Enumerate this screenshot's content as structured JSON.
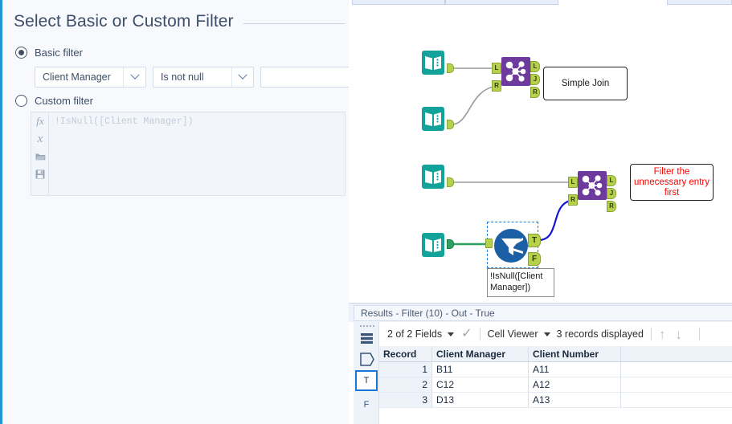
{
  "config_panel": {
    "title": "Select Basic or Custom Filter",
    "basic_filter": {
      "label": "Basic filter",
      "selected": true,
      "field": "Client Manager",
      "operator": "Is not null",
      "value": "",
      "value_placeholder": ""
    },
    "custom_filter": {
      "label": "Custom filter",
      "selected": false,
      "expression": "!IsNull([Client Manager])",
      "toolbar": {
        "function_icon": "fx",
        "variable_icon": "x",
        "open_icon": "folder-open",
        "save_icon": "floppy-save"
      }
    }
  },
  "canvas": {
    "tools": {
      "input_1_name": "input-data-tool",
      "input_2_name": "input-data-tool",
      "input_3_name": "input-data-tool",
      "input_4_name": "input-data-tool",
      "join_1_name": "join-tool",
      "join_2_name": "join-tool",
      "filter_name": "filter-tool"
    },
    "ports": {
      "left": "L",
      "right": "R",
      "join": "J",
      "true": "T",
      "false": "F"
    },
    "annotations": [
      {
        "text": "Simple Join",
        "color": "#1a1a1a"
      },
      {
        "text": "Filter the unnecessary entry first",
        "color": "#ff0000"
      }
    ],
    "filter_caption": "!IsNull([Client Manager])",
    "colors": {
      "input_tool": "#13a39a",
      "join_tool": "#6e3a9e",
      "filter_tool": "#1d5fa4",
      "port": "#b7d24a",
      "selected_wire": "#1414d8",
      "green_wire": "#2fa05f",
      "grey_wire": "#9a9a9a"
    }
  },
  "results": {
    "header": "Results - Filter (10) - Out - True",
    "toolbar": {
      "fields": "2 of 2 Fields",
      "check_icon": "check-icon",
      "view_mode": "Cell Viewer",
      "records_displayed": "3 records displayed",
      "up_arrow": "↑",
      "down_arrow": "↓"
    },
    "sidebar": {
      "drag_handle": "drag-handle",
      "records_icon": "records-stack-icon",
      "sum_icon": "sigma-icon",
      "true_tab": "T",
      "false_tab": "F"
    },
    "columns": [
      "Record",
      "Client Manager",
      "Client Number"
    ],
    "rows": [
      {
        "record": "1",
        "client_manager": "B11",
        "client_number": "A11"
      },
      {
        "record": "2",
        "client_manager": "C12",
        "client_number": "A12"
      },
      {
        "record": "3",
        "client_manager": "D13",
        "client_number": "A13"
      }
    ]
  }
}
